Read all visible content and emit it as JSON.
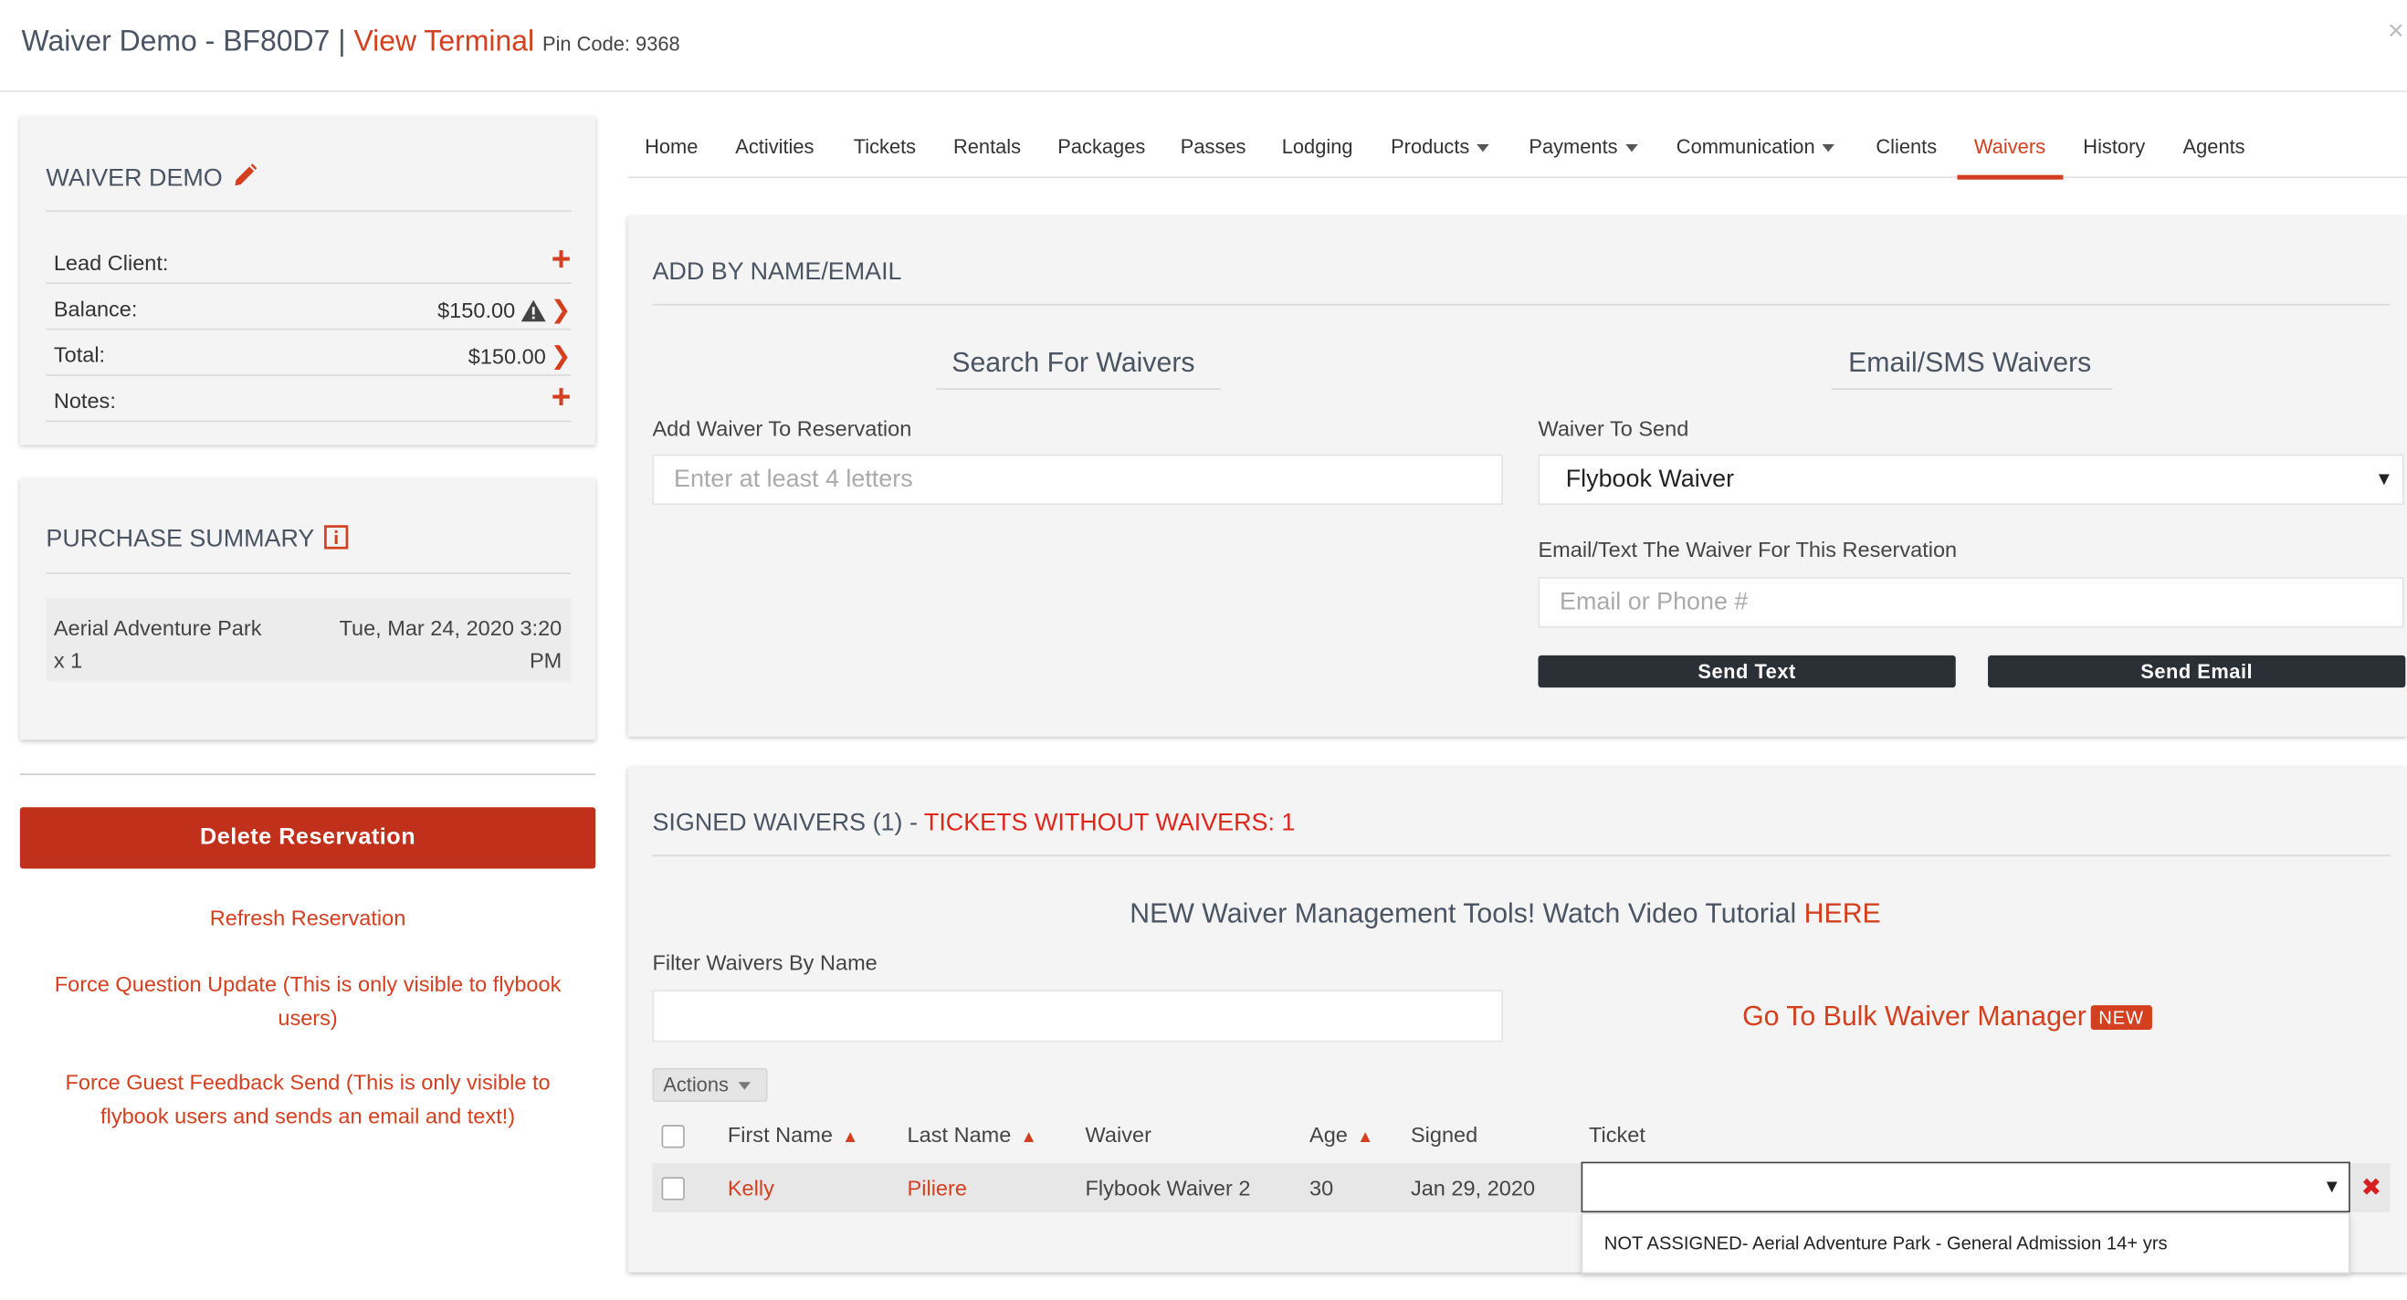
{
  "header": {
    "title": "Waiver Demo - BF80D7",
    "separator": "|",
    "view_terminal": "View Terminal",
    "pin_label": "Pin Code: 9368",
    "close": "×"
  },
  "summary": {
    "title": "WAIVER DEMO",
    "rows": [
      {
        "label": "Lead Client:",
        "value": ""
      },
      {
        "label": "Balance:",
        "value": "$150.00"
      },
      {
        "label": "Total:",
        "value": "$150.00"
      },
      {
        "label": "Notes:",
        "value": ""
      }
    ]
  },
  "purchase_summary": {
    "title": "PURCHASE SUMMARY",
    "item_name": "Aerial Adventure Park",
    "item_qty": "x 1",
    "item_date": "Tue, Mar 24, 2020 3:20",
    "item_time_suffix": "PM"
  },
  "sidebar_actions": {
    "delete": "Delete Reservation",
    "refresh": "Refresh Reservation",
    "force_question_1": "Force Question Update (This is only visible to flybook",
    "force_question_2": "users)",
    "force_feedback_1": "Force Guest Feedback Send (This is only visible to",
    "force_feedback_2": "flybook users and sends an email and text!)"
  },
  "nav": {
    "items": [
      {
        "label": "Home"
      },
      {
        "label": "Activities"
      },
      {
        "label": "Tickets"
      },
      {
        "label": "Rentals"
      },
      {
        "label": "Packages"
      },
      {
        "label": "Passes"
      },
      {
        "label": "Lodging"
      },
      {
        "label": "Products"
      },
      {
        "label": "Payments"
      },
      {
        "label": "Communication"
      },
      {
        "label": "Clients"
      },
      {
        "label": "Waivers"
      },
      {
        "label": "History"
      },
      {
        "label": "Agents"
      }
    ],
    "active": "Waivers"
  },
  "add_section": {
    "title": "ADD BY NAME/EMAIL",
    "search_heading": "Search For Waivers",
    "email_heading": "Email/SMS Waivers",
    "add_label": "Add Waiver To Reservation",
    "add_placeholder": "Enter at least 4 letters",
    "waiver_to_send_label": "Waiver To Send",
    "waiver_to_send_value": "Flybook Waiver",
    "email_text_label": "Email/Text The Waiver For This Reservation",
    "email_placeholder": "Email or Phone #",
    "send_text": "Send Text",
    "send_email": "Send Email"
  },
  "signed_section": {
    "title_prefix": "SIGNED WAIVERS (1) - ",
    "title_alert": "TICKETS WITHOUT WAIVERS: 1",
    "promo_text": "NEW Waiver Management Tools! Watch Video Tutorial",
    "promo_link": "HERE",
    "filter_label": "Filter Waivers By Name",
    "filter_value": "",
    "bulk_link": "Go To Bulk Waiver Manager",
    "bulk_badge": "NEW",
    "actions_label": "Actions",
    "columns": [
      "First Name",
      "Last Name",
      "Waiver",
      "Age",
      "Signed",
      "Ticket"
    ],
    "rows": [
      {
        "first_name": "Kelly",
        "last_name": "Piliere",
        "waiver": "Flybook Waiver 2",
        "age": "30",
        "signed": "Jan 29, 2020",
        "ticket": ""
      }
    ],
    "ticket_dropdown_option": "NOT ASSIGNED- Aerial Adventure Park - General Admission 14+ yrs"
  },
  "colors": {
    "accent": "#d4401f",
    "delete_button": "#c0301b",
    "dark_button": "#2b2f36",
    "card_bg": "#f4f4f4"
  }
}
